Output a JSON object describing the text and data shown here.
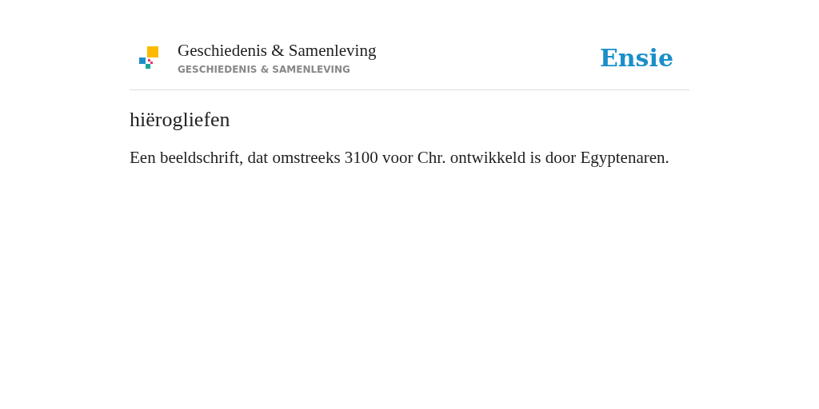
{
  "header": {
    "category_title": "Geschiedenis & Samenleving",
    "category_subtitle": "GESCHIEDENIS & SAMENLEVING",
    "brand": "Ensie"
  },
  "entry": {
    "term": "hiërogliefen",
    "definition": "Een beeldschrift, dat omstreeks 3100 voor Chr. ontwikkeld is door Egyptenaren."
  }
}
